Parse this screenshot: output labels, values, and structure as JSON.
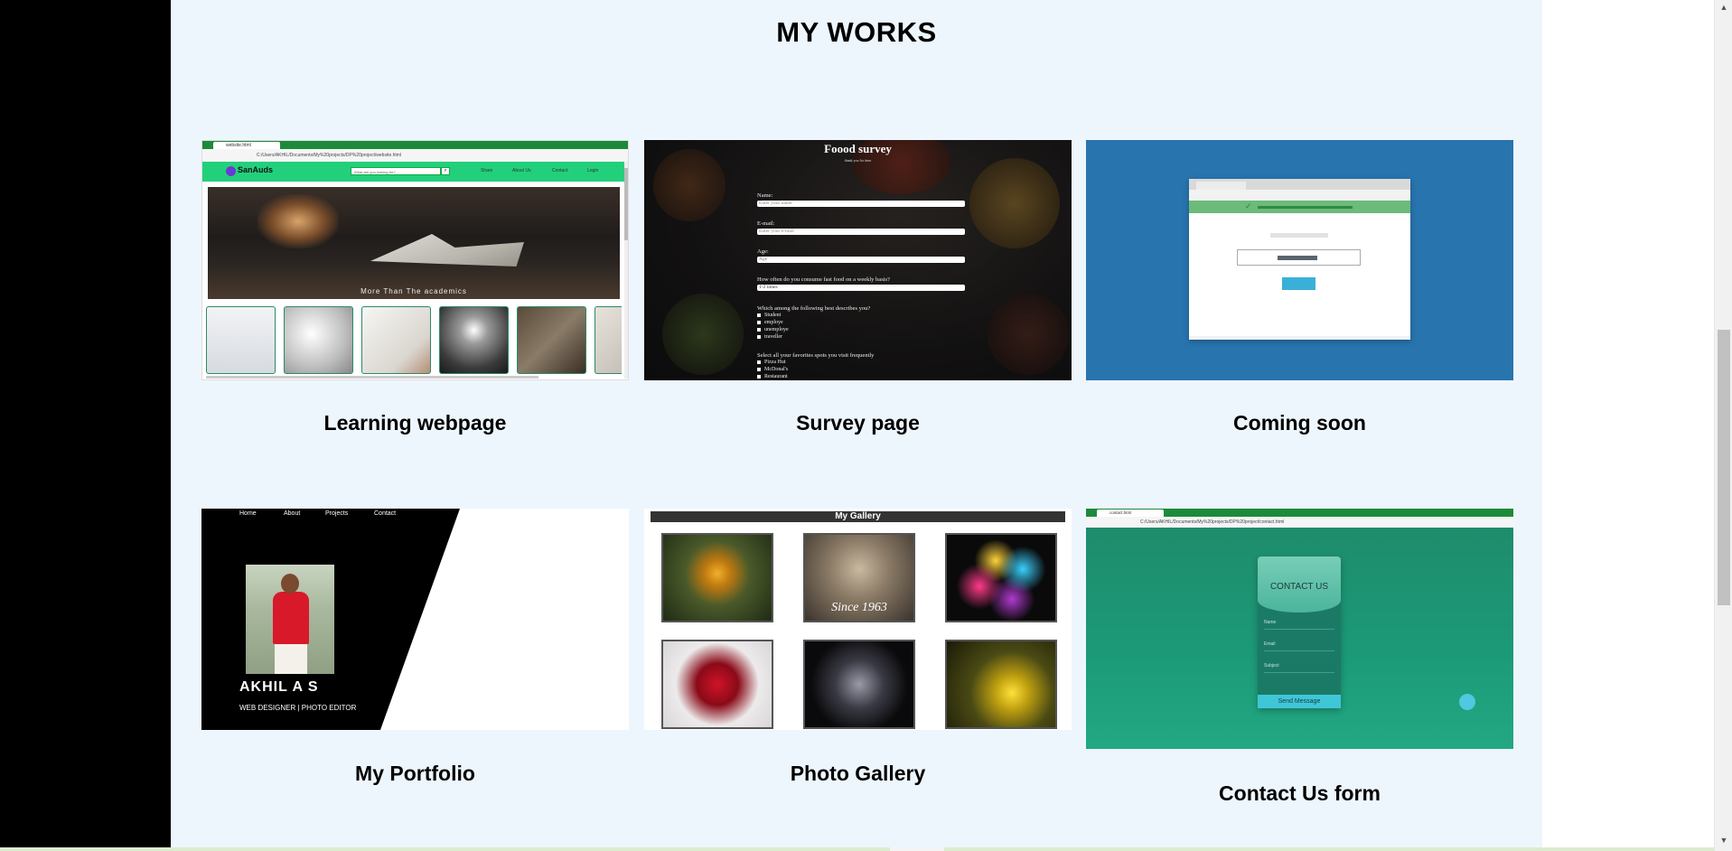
{
  "section": {
    "title": "MY WORKS"
  },
  "works": [
    {
      "caption": "Learning webpage",
      "thumb": {
        "tab_title": "website.html",
        "url": "C:/Users/AKHIL/Documents/My%20projects/DP%20project/website.html",
        "logo": "SanAuds",
        "search_placeholder": "What are you looking for?",
        "nav_links": [
          "Share",
          "About Us",
          "Contact",
          "Login"
        ],
        "hero_text": "More Than The academics"
      }
    },
    {
      "caption": "Survey page",
      "thumb": {
        "title": "Foood survey",
        "subtitle": "thank you for time",
        "name_label": "Name:",
        "name_placeholder": "Enter your name",
        "email_label": "E-mail:",
        "email_placeholder": "Enter your e-mail",
        "age_label": "Age:",
        "age_placeholder": "Age",
        "freq_label": "How often do you consume fast food on a weekly basis?",
        "freq_value": "1-2 times",
        "describe_label": "Which among the following best describes you?",
        "describe_options": [
          "Student",
          "employe",
          "unemploye",
          "traveller"
        ],
        "spots_label": "Select all your favorites spots you visit frequently",
        "spots_options": [
          "Pizza Hut",
          "McDonal's",
          "Restaurant"
        ]
      }
    },
    {
      "caption": "Coming soon"
    },
    {
      "caption": "My Portfolio",
      "thumb": {
        "nav_links": [
          "Home",
          "About",
          "Projects",
          "Contact"
        ],
        "name": "AKHIL A S",
        "role": "WEB DESIGNER | PHOTO EDITOR"
      }
    },
    {
      "caption": "Photo Gallery",
      "thumb": {
        "heading": "My Gallery",
        "coin_text": "Since 1963"
      }
    },
    {
      "caption": "Contact Us form",
      "thumb": {
        "tab_title": "contact.html",
        "url": "C:/Users/AKHIL/Documents/My%20projects/DP%20project/contact.html",
        "title": "CONTACT US",
        "fields": [
          "Name",
          "Email",
          "Subject"
        ],
        "button": "Send Message"
      }
    }
  ],
  "colors": {
    "page_bg": "#eef6fd",
    "left_panel": "#000000",
    "coming_soon_bg": "#2874ae",
    "contact_bg": "#1c9a78",
    "nav_green": "#22d07c"
  }
}
